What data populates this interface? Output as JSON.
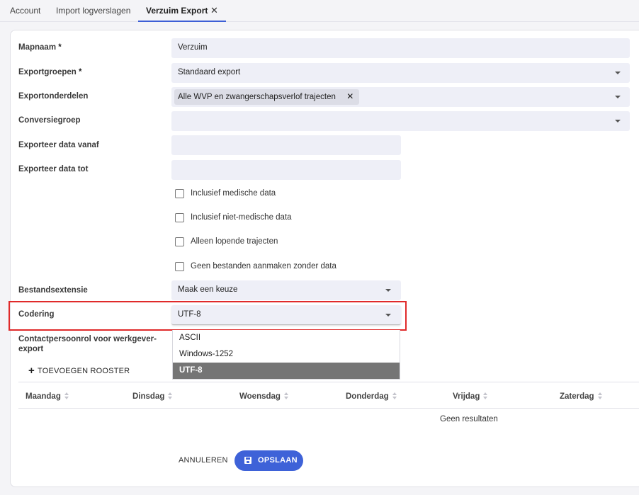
{
  "tabs": [
    {
      "label": "Account"
    },
    {
      "label": "Import logverslagen"
    },
    {
      "label": "Verzuim Export",
      "close": "✕"
    }
  ],
  "form": {
    "mapnaam": {
      "label": "Mapnaam",
      "required": "*",
      "value": "Verzuim"
    },
    "exportgroepen": {
      "label": "Exportgroepen",
      "required": "*",
      "value": "Standaard export"
    },
    "exportonderdelen": {
      "label": "Exportonderdelen",
      "chip": "Alle WVP en zwangerschapsverlof trajecten",
      "chip_remove": "✕"
    },
    "conversiegroep": {
      "label": "Conversiegroep",
      "value": ""
    },
    "vanaf": {
      "label": "Exporteer data vanaf",
      "value": ""
    },
    "tot": {
      "label": "Exporteer data tot",
      "value": ""
    },
    "checkboxes": [
      {
        "label": "Inclusief medische data",
        "checked": false
      },
      {
        "label": "Inclusief niet-medische data",
        "checked": false
      },
      {
        "label": "Alleen lopende trajecten",
        "checked": false
      },
      {
        "label": "Geen bestanden aanmaken zonder data",
        "checked": false
      }
    ],
    "bestandsextensie": {
      "label": "Bestandsextensie",
      "value": "Maak een keuze"
    },
    "codering": {
      "label": "Codering",
      "value": "UTF-8",
      "options": [
        "ASCII",
        "Windows-1252",
        "UTF-8"
      ],
      "selected": "UTF-8"
    },
    "contactpersoonrol": {
      "label_line1": "Contactpersoonrol voor werkgever-",
      "label_line2": "export"
    }
  },
  "rooster": {
    "add_label": "TOEVOEGEN ROOSTER",
    "add_icon": "+",
    "columns": [
      "Maandag",
      "Dinsdag",
      "Woensdag",
      "Donderdag",
      "Vrijdag",
      "Zaterdag"
    ],
    "empty_text": "Geen resultaten"
  },
  "actions": {
    "cancel": "ANNULEREN",
    "save": "OPSLAAN"
  },
  "colors": {
    "accent": "#3e62d8",
    "highlight": "#e02a2a",
    "field_bg": "#eeeff7",
    "selected_option": "#757575"
  }
}
